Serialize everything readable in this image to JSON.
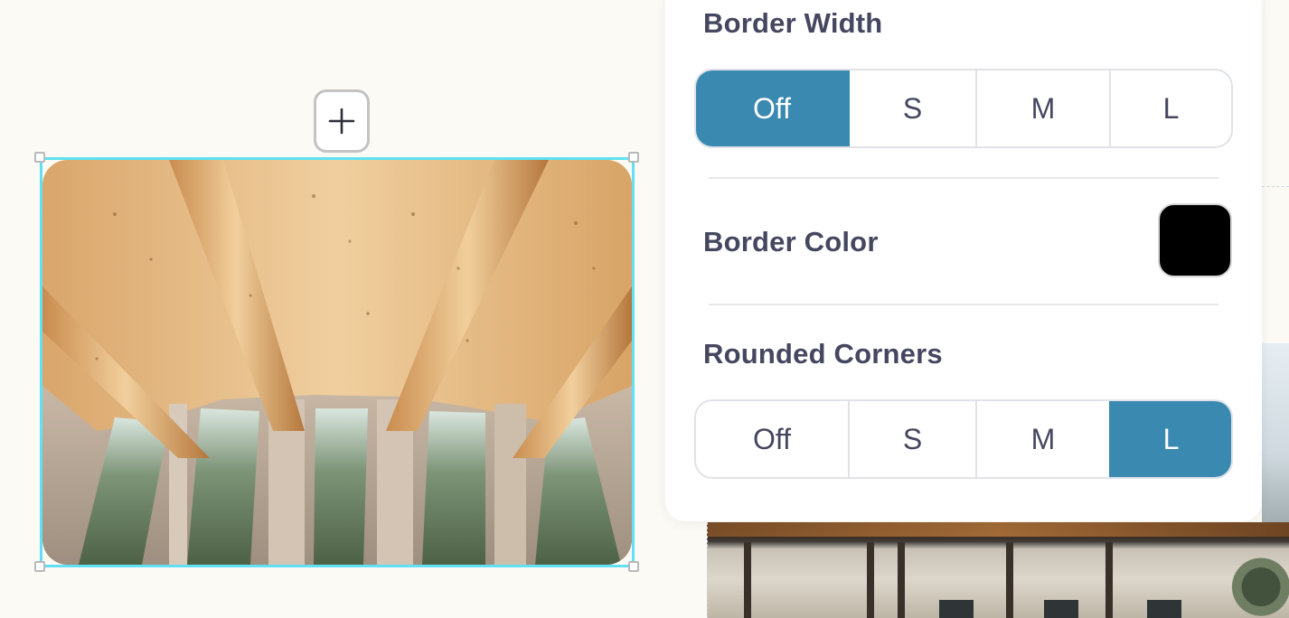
{
  "settings": {
    "border_width": {
      "title": "Border Width",
      "options": [
        "Off",
        "S",
        "M",
        "L"
      ],
      "selected": "Off"
    },
    "border_color": {
      "title": "Border Color",
      "value": "#000000"
    },
    "rounded_corners": {
      "title": "Rounded Corners",
      "options": [
        "Off",
        "S",
        "M",
        "L"
      ],
      "selected": "L"
    }
  },
  "canvas": {
    "add_block_icon": "plus-icon",
    "selection_color": "#62e0f3",
    "accent_color": "#3a89b0"
  }
}
